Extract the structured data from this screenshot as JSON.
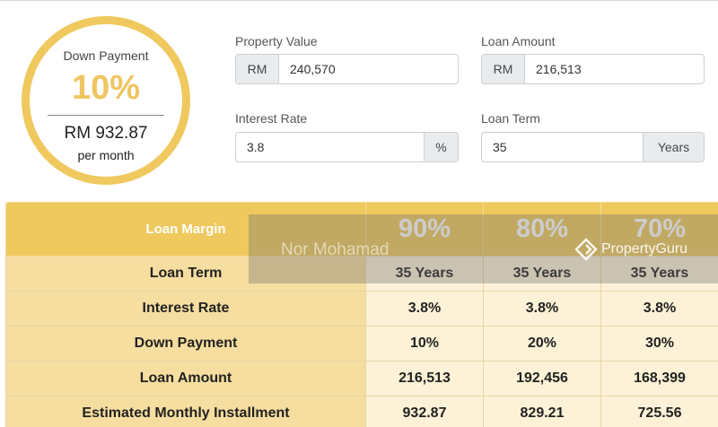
{
  "summary": {
    "label": "Down Payment",
    "percent": "10%",
    "monthly": "RM 932.87",
    "per_month": "per month"
  },
  "form": {
    "property_value": {
      "label": "Property Value",
      "prefix": "RM",
      "value": "240,570"
    },
    "loan_amount": {
      "label": "Loan Amount",
      "prefix": "RM",
      "value": "216,513"
    },
    "interest_rate": {
      "label": "Interest Rate",
      "value": "3.8",
      "suffix": "%"
    },
    "loan_term": {
      "label": "Loan Term",
      "value": "35",
      "suffix": "Years"
    }
  },
  "table": {
    "header_label": "Loan Margin",
    "columns": [
      "90%",
      "80%",
      "70%"
    ],
    "rows": [
      {
        "label": "Loan Term",
        "values": [
          "35 Years",
          "35 Years",
          "35 Years"
        ]
      },
      {
        "label": "Interest Rate",
        "values": [
          "3.8%",
          "3.8%",
          "3.8%"
        ]
      },
      {
        "label": "Down Payment",
        "values": [
          "10%",
          "20%",
          "30%"
        ]
      },
      {
        "label": "Loan Amount",
        "values": [
          "216,513",
          "192,456",
          "168,399"
        ]
      },
      {
        "label": "Estimated Monthly Installment",
        "values": [
          "932.87",
          "829.21",
          "725.56"
        ]
      }
    ]
  },
  "watermark": {
    "name": "Nor Mohamad",
    "brand": "PropertyGuru"
  },
  "colors": {
    "accent": "#efc95e",
    "label_bg": "#f6dea0",
    "value_bg": "#fdf2d7"
  }
}
